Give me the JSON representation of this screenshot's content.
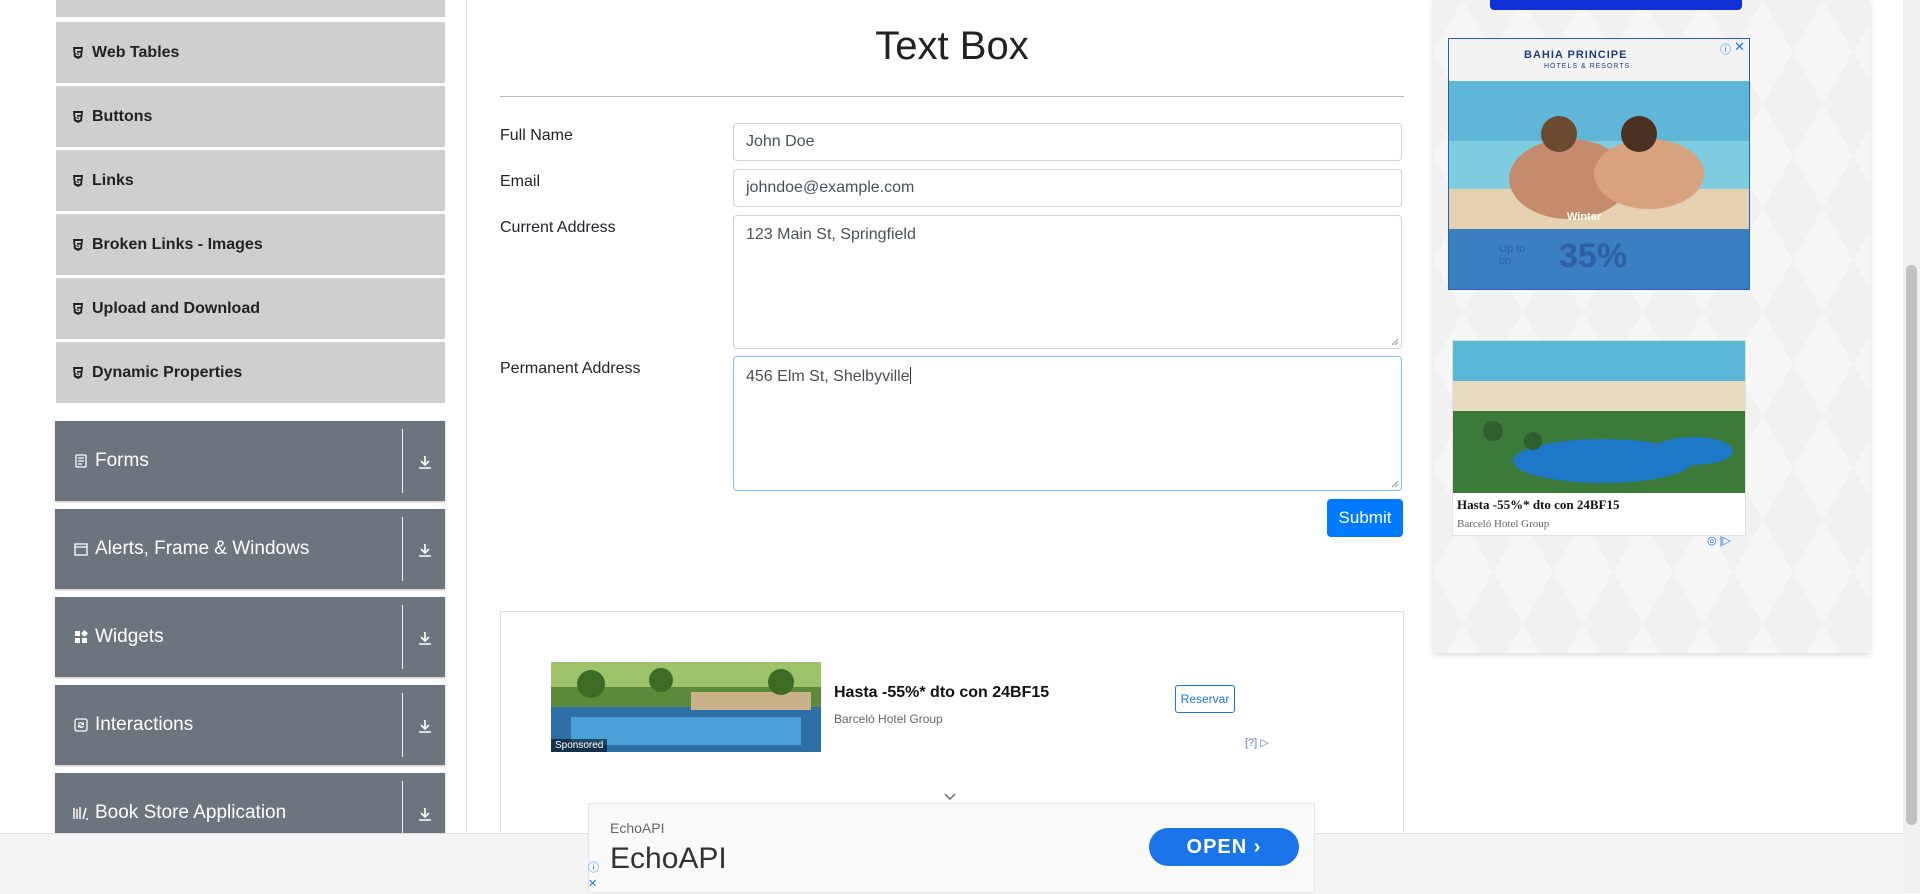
{
  "sidebar": {
    "sub_items": [
      {
        "label": "Web Tables"
      },
      {
        "label": "Buttons"
      },
      {
        "label": "Links"
      },
      {
        "label": "Broken Links - Images"
      },
      {
        "label": "Upload and Download"
      },
      {
        "label": "Dynamic Properties"
      }
    ],
    "groups": [
      {
        "label": "Forms",
        "icon": "document-icon"
      },
      {
        "label": "Alerts, Frame & Windows",
        "icon": "window-icon"
      },
      {
        "label": "Widgets",
        "icon": "widgets-icon"
      },
      {
        "label": "Interactions",
        "icon": "refresh-icon"
      },
      {
        "label": "Book Store Application",
        "icon": "books-icon"
      }
    ]
  },
  "main": {
    "title": "Text Box",
    "form": {
      "full_name_label": "Full Name",
      "full_name_value": "John Doe",
      "email_label": "Email",
      "email_value": "johndoe@example.com",
      "current_address_label": "Current Address",
      "current_address_value": "123 Main St, Springfield",
      "permanent_address_label": "Permanent Address",
      "permanent_address_value": "456 Elm St, Shelbyville",
      "submit_label": "Submit"
    },
    "ad_banner": {
      "title": "Hasta -55%* dto con 24BF15",
      "advertiser": "Barceló Hotel Group",
      "button": "Reservar",
      "sponsored": "Sponsored",
      "adchoices": "[?]"
    }
  },
  "right_rail": {
    "ad1": {
      "brand": "BAHIA PRINCIPE",
      "brand_sub": "HOTELS & RESORTS",
      "season": "Winter",
      "up_to": "Up to",
      "on": "on",
      "discount": "35%"
    },
    "ad2": {
      "title": "Hasta -55%* dto con 24BF15",
      "advertiser": "Barceló Hotel Group"
    }
  },
  "bottom_ad": {
    "small": "EchoAPI",
    "big": "EchoAPI",
    "button": "OPEN"
  },
  "colors": {
    "sidebar_group_bg": "#6c757d",
    "sidebar_sub_bg": "#cfcfcf",
    "primary": "#007bff"
  }
}
